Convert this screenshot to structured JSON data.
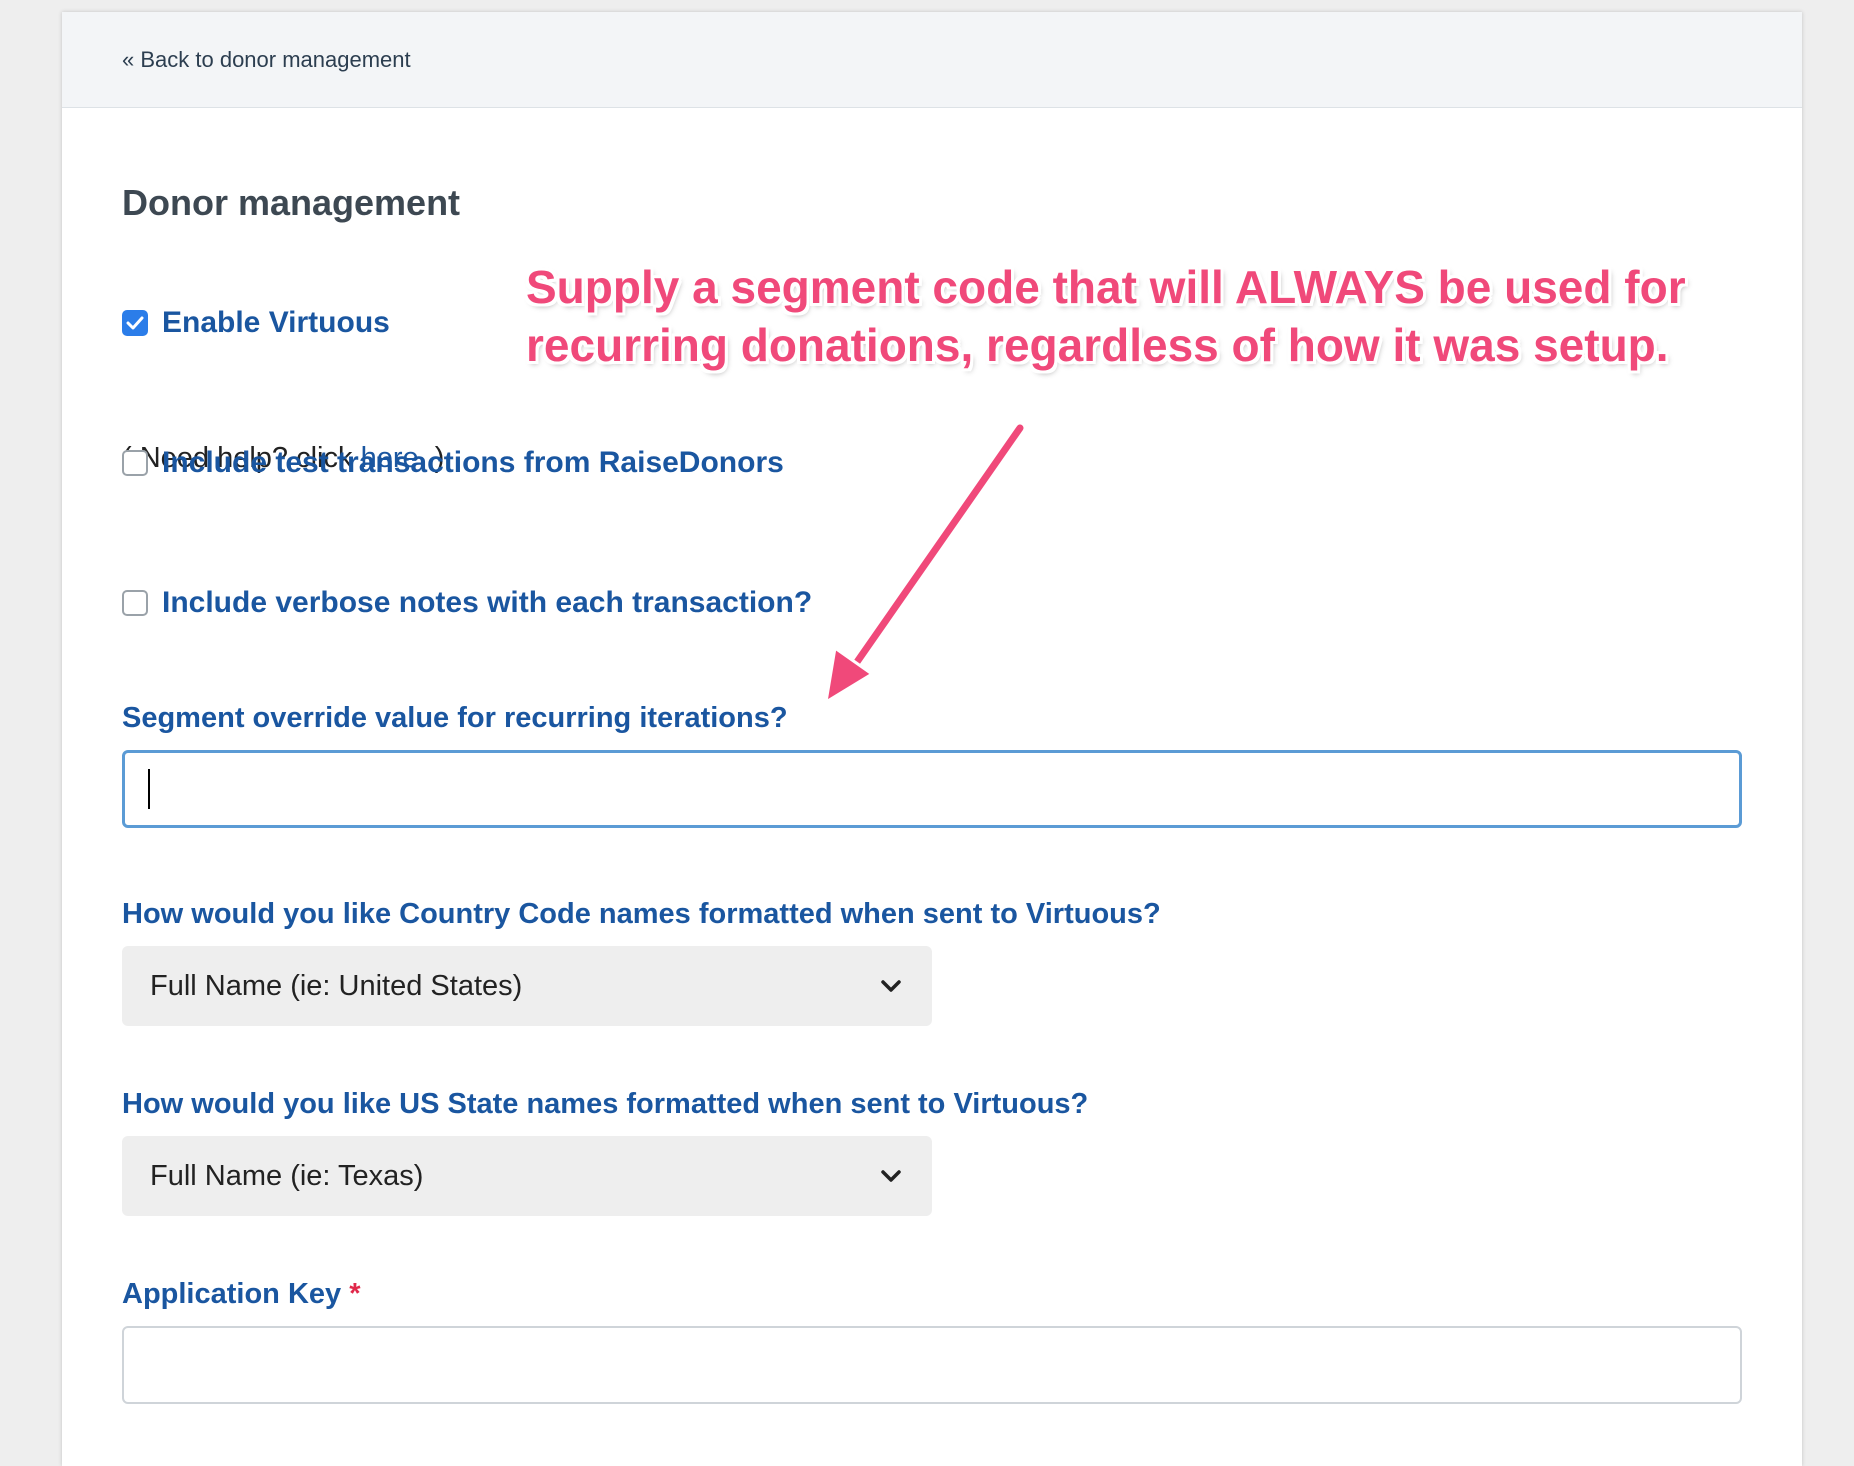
{
  "header": {
    "back_link": "« Back to donor management"
  },
  "page": {
    "title": "Donor management"
  },
  "options": {
    "enable_virtuous": {
      "label": "Enable Virtuous",
      "checked": true
    },
    "help_prefix": "( Need help? click ",
    "help_link": "here",
    "help_suffix": ". )",
    "include_test": {
      "label": "Include test transactions from RaiseDonors",
      "checked": false
    },
    "include_verbose": {
      "label": "Include verbose notes with each transaction?",
      "checked": false
    }
  },
  "fields": {
    "segment_override": {
      "label": "Segment override value for recurring iterations?",
      "value": ""
    },
    "country_format": {
      "label": "How would you like Country Code names formatted when sent to Virtuous?",
      "selected": "Full Name (ie: United States)"
    },
    "state_format": {
      "label": "How would you like US State names formatted when sent to Virtuous?",
      "selected": "Full Name (ie: Texas)"
    },
    "application_key": {
      "label": "Application Key",
      "required_marker": "*",
      "value": ""
    }
  },
  "annotation": {
    "line1": "Supply a segment code that will ALWAYS be used for",
    "line2": "recurring donations, regardless of how it was setup."
  },
  "colors": {
    "label_blue": "#1a56a0",
    "checkbox_blue": "#2b7de9",
    "annotation_pink": "#f0497a",
    "required_red": "#e0284a"
  },
  "icons": {
    "checkmark": "check-icon",
    "dropdown": "chevron-down-icon",
    "annotation_arrow": "arrow-icon"
  }
}
